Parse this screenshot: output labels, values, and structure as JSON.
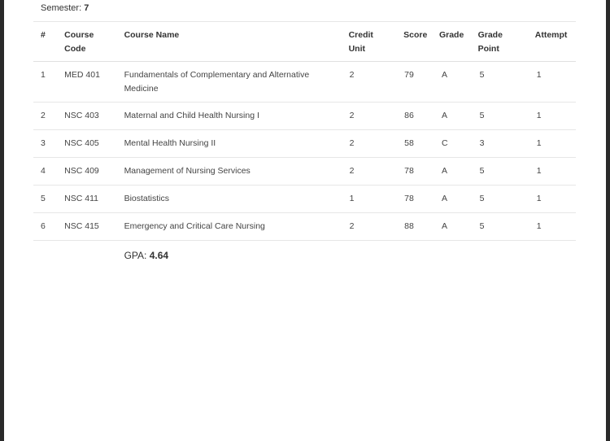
{
  "semester": {
    "label": "Semester:",
    "value": "7"
  },
  "table": {
    "headers": {
      "num": "#",
      "code": "Course Code",
      "name": "Course Name",
      "unit": "Credit Unit",
      "score": "Score",
      "grade": "Grade",
      "grade_point": "Grade Point",
      "attempt": "Attempt"
    },
    "rows": [
      {
        "num": "1",
        "code": "MED 401",
        "name": "Fundamentals of Complementary and Alternative Medicine",
        "unit": "2",
        "score": "79",
        "grade": "A",
        "grade_point": "5",
        "attempt": "1"
      },
      {
        "num": "2",
        "code": "NSC 403",
        "name": "Maternal and Child Health Nursing I",
        "unit": "2",
        "score": "86",
        "grade": "A",
        "grade_point": "5",
        "attempt": "1"
      },
      {
        "num": "3",
        "code": "NSC 405",
        "name": "Mental Health Nursing II",
        "unit": "2",
        "score": "58",
        "grade": "C",
        "grade_point": "3",
        "attempt": "1"
      },
      {
        "num": "4",
        "code": "NSC 409",
        "name": "Management of Nursing Services",
        "unit": "2",
        "score": "78",
        "grade": "A",
        "grade_point": "5",
        "attempt": "1"
      },
      {
        "num": "5",
        "code": "NSC 411",
        "name": "Biostatistics",
        "unit": "1",
        "score": "78",
        "grade": "A",
        "grade_point": "5",
        "attempt": "1"
      },
      {
        "num": "6",
        "code": "NSC 415",
        "name": "Emergency and Critical Care Nursing",
        "unit": "2",
        "score": "88",
        "grade": "A",
        "grade_point": "5",
        "attempt": "1"
      }
    ]
  },
  "gpa": {
    "label": "GPA:",
    "value": "4.64"
  }
}
